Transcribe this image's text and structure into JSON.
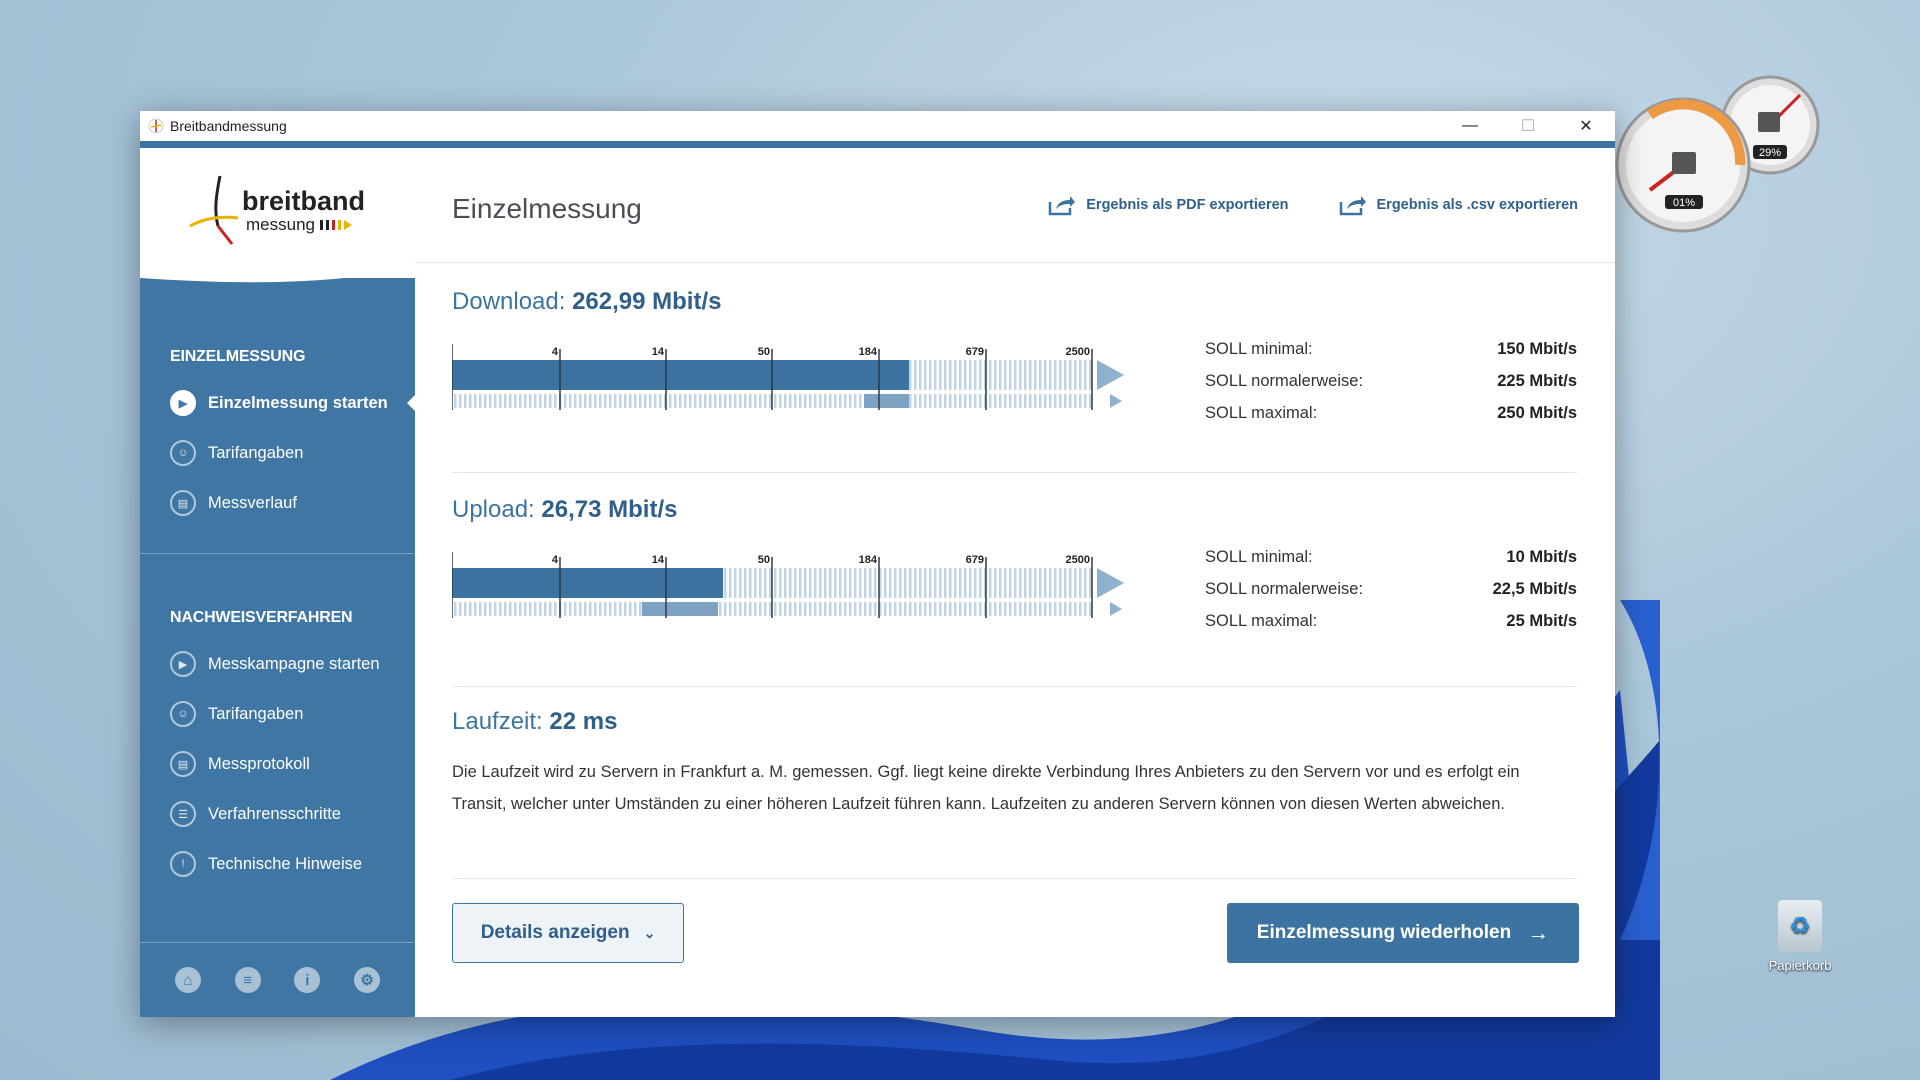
{
  "window": {
    "title": "Breitbandmessung",
    "minimize": "—",
    "maximize": "☐",
    "close": "✕"
  },
  "logo": {
    "line1": "breitband",
    "line2": "messung"
  },
  "sidebar": {
    "section1_title": "EINZELMESSUNG",
    "section1_items": [
      {
        "label": "Einzelmessung starten",
        "icon": "play-icon",
        "active": true
      },
      {
        "label": "Tarifangaben",
        "icon": "user-icon"
      },
      {
        "label": "Messverlauf",
        "icon": "clipboard-icon"
      }
    ],
    "section2_title": "NACHWEISVERFAHREN",
    "section2_items": [
      {
        "label": "Messkampagne starten",
        "icon": "play-icon"
      },
      {
        "label": "Tarifangaben",
        "icon": "user-icon"
      },
      {
        "label": "Messprotokoll",
        "icon": "clipboard-icon"
      },
      {
        "label": "Verfahrensschritte",
        "icon": "list-icon"
      },
      {
        "label": "Technische Hinweise",
        "icon": "warning-icon"
      }
    ],
    "footer_icons": [
      "home-icon",
      "chat-icon",
      "info-icon",
      "gear-icon"
    ]
  },
  "main": {
    "title": "Einzelmessung",
    "export_pdf": "Ergebnis als PDF exportieren",
    "export_csv": "Ergebnis als .csv exportieren",
    "download": {
      "label": "Download:",
      "value": "262,99 Mbit/s",
      "ticks": [
        "4",
        "14",
        "50",
        "184",
        "679",
        "2500"
      ],
      "soll": [
        {
          "label": "SOLL minimal:",
          "value": "150 Mbit/s"
        },
        {
          "label": "SOLL normalerweise:",
          "value": "225 Mbit/s"
        },
        {
          "label": "SOLL maximal:",
          "value": "250 Mbit/s"
        }
      ]
    },
    "upload": {
      "label": "Upload:",
      "value": "26,73 Mbit/s",
      "ticks": [
        "4",
        "14",
        "50",
        "184",
        "679",
        "2500"
      ],
      "soll": [
        {
          "label": "SOLL minimal:",
          "value": "10 Mbit/s"
        },
        {
          "label": "SOLL normalerweise:",
          "value": "22,5 Mbit/s"
        },
        {
          "label": "SOLL maximal:",
          "value": "25 Mbit/s"
        }
      ]
    },
    "latency": {
      "label": "Laufzeit:",
      "value": "22 ms",
      "text": "Die Laufzeit wird zu Servern in Frankfurt a. M. gemessen. Ggf. liegt keine direkte Verbindung Ihres Anbieters zu den Servern vor und es erfolgt ein Transit, welcher unter Umständen zu einer höheren Laufzeit führen kann. Laufzeiten zu anderen Servern können von diesen Werten abweichen."
    },
    "details_button": "Details anzeigen",
    "repeat_button": "Einzelmessung wiederholen"
  },
  "desktop": {
    "gadget_cpu": "01%",
    "gadget_mem": "29%",
    "recycle_bin": "Papierkorb"
  },
  "colors": {
    "accent": "#3d73a0",
    "accent_dark": "#2f5f8a",
    "sidebar": "#3f76a3"
  }
}
